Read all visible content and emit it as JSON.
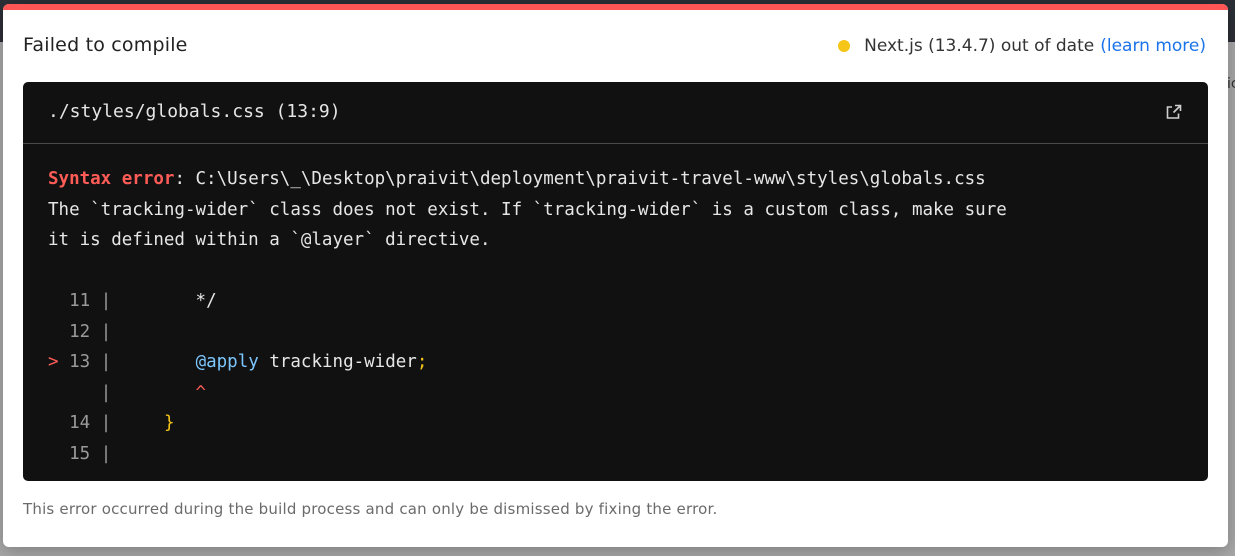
{
  "backdrop": {
    "peek_text": "ic"
  },
  "header": {
    "title": "Failed to compile",
    "version_text": "Next.js (13.4.7) out of date",
    "learn_more": "(learn more)",
    "status_color": "#f5c518"
  },
  "code_panel": {
    "file_path": "./styles/globals.css (13:9)",
    "error": {
      "label": "Syntax error",
      "path": ": C:\\Users\\_\\Desktop\\praivit\\deployment\\praivit-travel-www\\styles\\globals.css",
      "message_line1": "The `tracking-wider` class does not exist. If `tracking-wider` is a custom class, make sure",
      "message_line2": "it is defined within a `@layer` directive."
    },
    "lines": [
      {
        "marker": "",
        "num": "11",
        "code": "       */"
      },
      {
        "marker": "",
        "num": "12",
        "code": ""
      },
      {
        "marker": ">",
        "num": "13",
        "keyword": "@apply",
        "code": " tracking-wider",
        "punct": ";"
      },
      {
        "marker": "",
        "num": "",
        "caret": "^"
      },
      {
        "marker": "",
        "num": "14",
        "brace": "}"
      },
      {
        "marker": "",
        "num": "15",
        "code": ""
      }
    ]
  },
  "footer": {
    "note": "This error occurred during the build process and can only be dismissed by fixing the error."
  },
  "colors": {
    "accent": "#ff5555",
    "panel_bg": "#111111",
    "link": "#1a73e8"
  }
}
